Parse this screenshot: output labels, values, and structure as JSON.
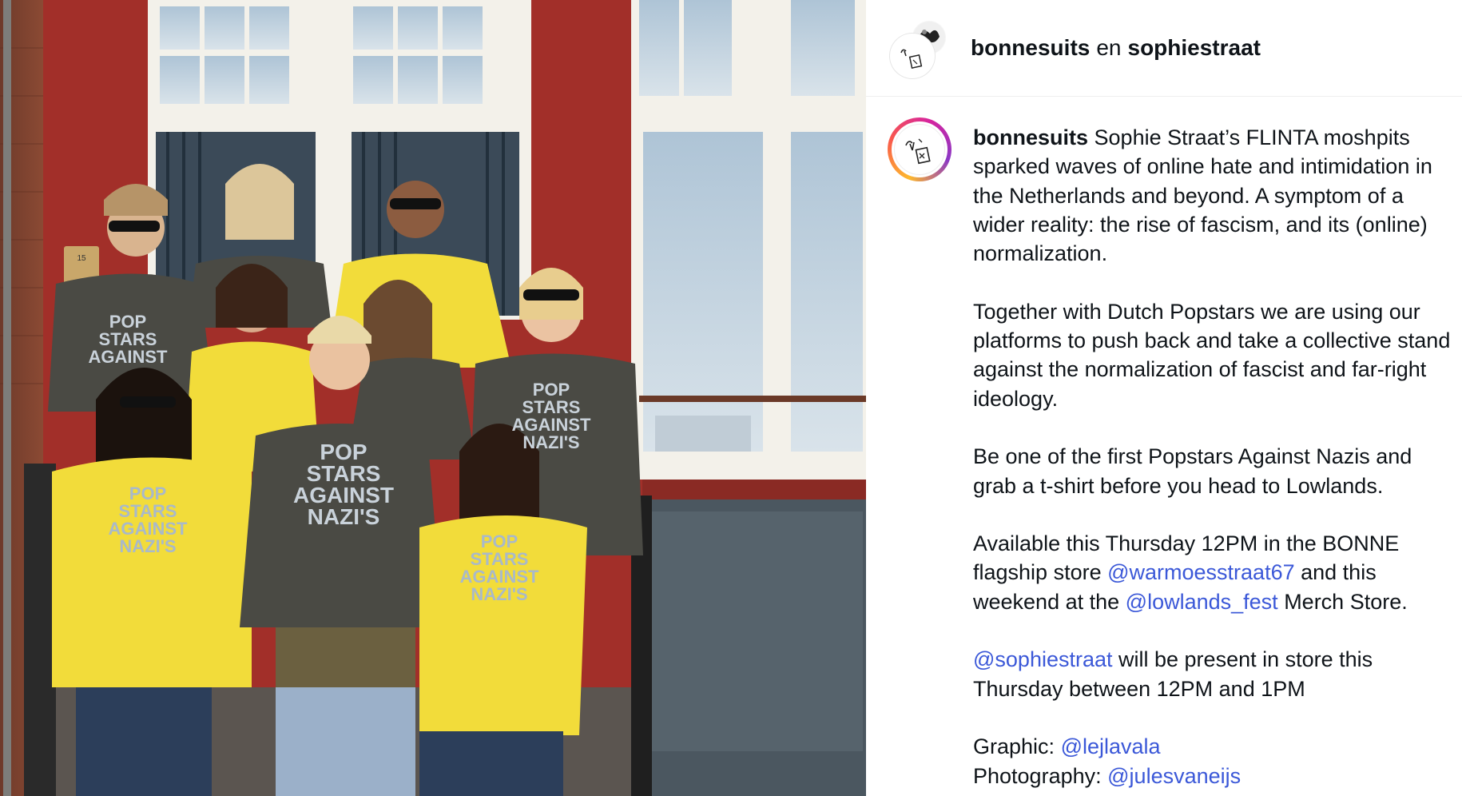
{
  "header": {
    "user1": "bonnesuits",
    "joiner": "en",
    "user2": "sophiestraat"
  },
  "caption": {
    "username": "bonnesuits",
    "p1": "Sophie Straat’s FLINTA moshpits sparked waves of online hate and intimidation in the Netherlands and beyond. A symptom of a wider reality: the rise of fascism, and its (online) normalization.",
    "p2": "Together with Dutch Popstars we are using our platforms to push back and take a collective stand against the normalization of fascist and far-right ideology.",
    "p3": "Be one of the first Popstars Against Nazis and grab a t-shirt before you head to Lowlands.",
    "p4_a": "Available this Thursday 12PM in the BONNE flagship store",
    "p4_mention1": "@warmoesstraat67",
    "p4_b": "and this weekend at the",
    "p4_mention2": "@lowlands_fest",
    "p4_c": "Merch Store.",
    "p5_mention": "@sophiestraat",
    "p5_text": "will be present in store this Thursday between 12PM and 1PM",
    "graphic_label": "Graphic:",
    "graphic_mention": "@lejlavala",
    "photo_label": "Photography:",
    "photo_mention": "@julesvaneijs"
  },
  "photo": {
    "shirt_text": [
      "POP",
      "STARS",
      "AGAINST",
      "NAZI'S"
    ],
    "doorbell": "15"
  },
  "colors": {
    "mention": "#3b58d8",
    "brick_red": "#8a2a24",
    "shirt_yellow": "#f2dc3a",
    "shirt_grey": "#4a4a44"
  }
}
